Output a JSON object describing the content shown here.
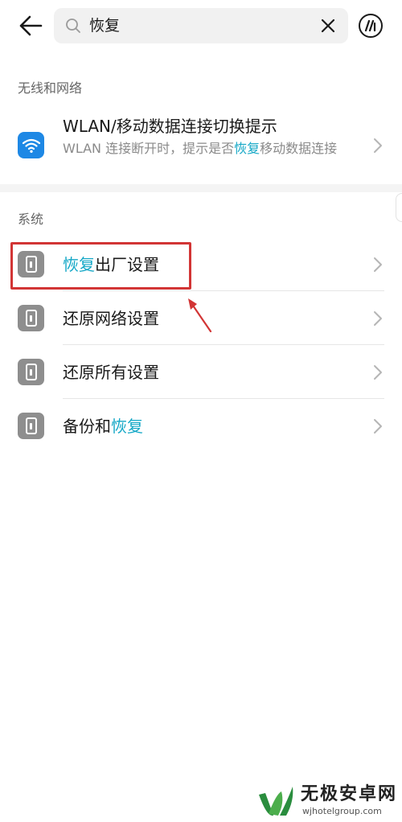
{
  "search": {
    "query": "恢复"
  },
  "sections": {
    "wireless": "无线和网络",
    "system": "系统"
  },
  "wlan": {
    "title": "WLAN/移动数据连接切换提示",
    "desc_before": "WLAN 连接断开时，提示是否",
    "desc_highlight": "恢复",
    "desc_after": "移动数据连接"
  },
  "system_items": [
    {
      "highlight_before": "恢复",
      "label": "出厂设置",
      "highlight_after": ""
    },
    {
      "highlight_before": "",
      "label": "还原网络设置",
      "highlight_after": ""
    },
    {
      "highlight_before": "",
      "label": "还原所有设置",
      "highlight_after": ""
    },
    {
      "highlight_before": "",
      "label": "备份和",
      "highlight_after": "恢复"
    }
  ],
  "watermark": {
    "title": "无极安卓网",
    "url": "wjhotelgroup.com"
  },
  "colors": {
    "highlight": "#13a7c6",
    "wifi_icon_bg": "#1e88e5",
    "settings_icon_bg": "#8e8e8e",
    "annotation": "#d23535"
  },
  "icons": {
    "back": "arrow-left-icon",
    "search": "search-icon",
    "clear": "close-icon",
    "ai": "ai-assistant-icon",
    "wifi": "wifi-icon",
    "settings": "settings-info-icon",
    "chevron": "chevron-right-icon"
  }
}
